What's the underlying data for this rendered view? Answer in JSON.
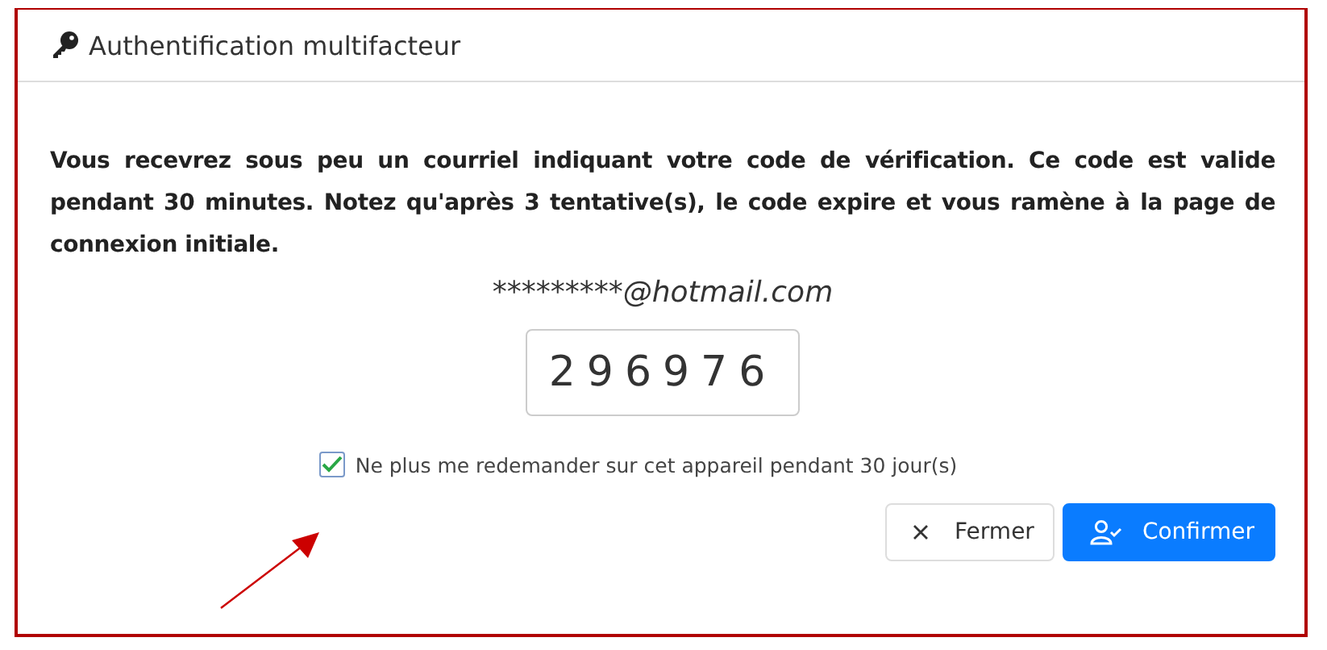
{
  "dialog": {
    "title": "Authentification multifacteur"
  },
  "message": "Vous recevrez sous peu un courriel indiquant votre code de vérification. Ce code est valide pendant 30 minutes. Notez qu'après 3 tentative(s), le code expire et vous ramène à la page de connexion initiale.",
  "email": "*********@hotmail.com",
  "code": {
    "value": "296976"
  },
  "remember": {
    "label": "Ne plus me redemander sur cet appareil pendant 30 jour(s)",
    "checked": true
  },
  "buttons": [
    {
      "kind": "close",
      "label": "Fermer"
    },
    {
      "kind": "confirm",
      "label": "Confirmer"
    }
  ]
}
